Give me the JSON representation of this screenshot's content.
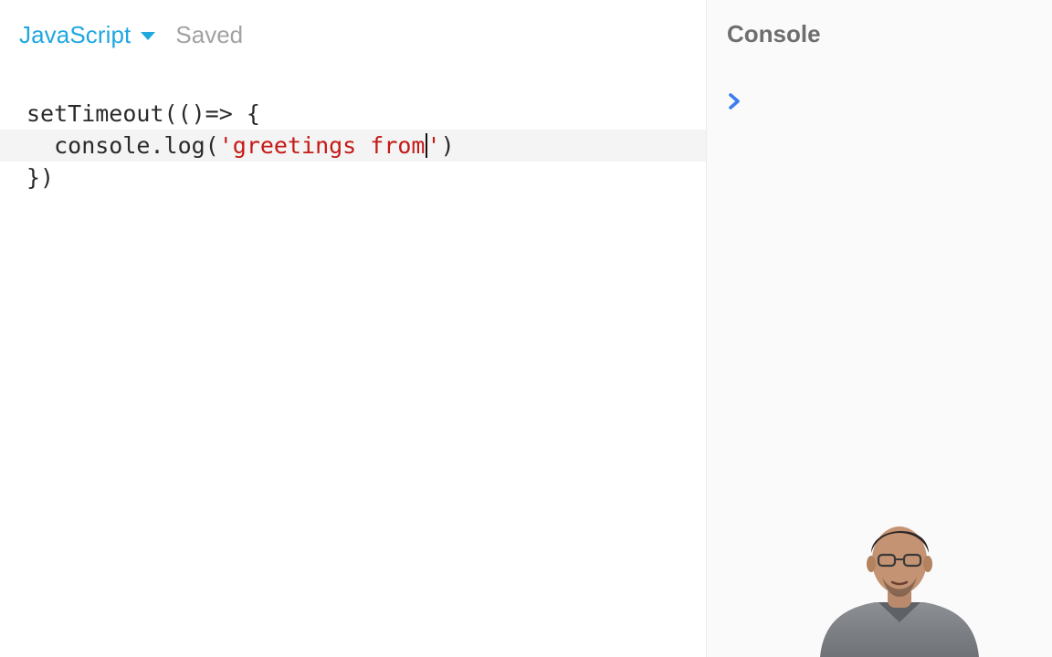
{
  "editor": {
    "language": "JavaScript",
    "status": "Saved",
    "code_lines": [
      [
        {
          "t": "setTimeout(()=> {",
          "c": "plain"
        }
      ],
      [
        {
          "t": "  console.log(",
          "c": "plain"
        },
        {
          "t": "'greetings from",
          "c": "string"
        },
        {
          "t": "|",
          "c": "cursor"
        },
        {
          "t": "'",
          "c": "string"
        },
        {
          "t": ")",
          "c": "plain"
        }
      ],
      [
        {
          "t": "})",
          "c": "plain"
        }
      ]
    ],
    "active_line": 1
  },
  "console": {
    "title": "Console",
    "prompt_icon": "chevron-right-icon"
  },
  "colors": {
    "accent": "#1fa7e0",
    "string": "#c41a16",
    "prompt": "#3b7cf0",
    "status": "#a2a2a2"
  }
}
